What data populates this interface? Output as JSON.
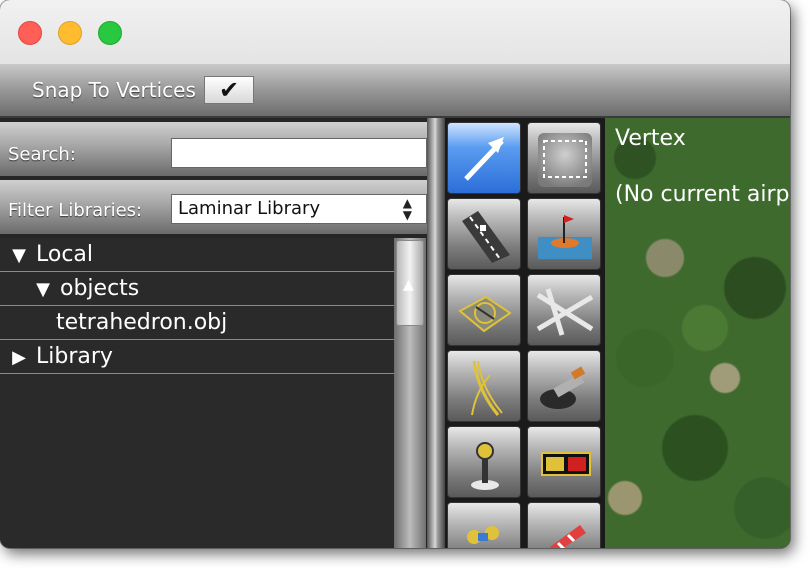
{
  "toolbar": {
    "snap_label": "Snap To Vertices",
    "snap_checked": true,
    "check_glyph": "✔"
  },
  "library": {
    "search_label": "Search:",
    "search_value": "",
    "filter_label": "Filter Libraries:",
    "filter_value": "Laminar Library",
    "tree": [
      {
        "label": "Local",
        "expanded": true,
        "indent": 0
      },
      {
        "label": "objects",
        "expanded": true,
        "indent": 1
      },
      {
        "label": "tetrahedron.obj",
        "leaf": true,
        "indent": 2
      },
      {
        "label": "Library",
        "expanded": false,
        "indent": 0
      }
    ]
  },
  "tools": [
    {
      "name": "vertex-tool",
      "icon": "arrow-icon",
      "selected": true
    },
    {
      "name": "marquee-tool",
      "icon": "marquee-icon",
      "selected": false
    },
    {
      "name": "runway-tool",
      "icon": "runway-icon",
      "selected": false
    },
    {
      "name": "sealane-tool",
      "icon": "sealane-icon",
      "selected": false
    },
    {
      "name": "helipad-tool",
      "icon": "helipad-icon",
      "selected": false
    },
    {
      "name": "taxiway-tool",
      "icon": "taxiway-icon",
      "selected": false
    },
    {
      "name": "taxi-route-tool",
      "icon": "taxi-route-icon",
      "selected": false
    },
    {
      "name": "boundary-tool",
      "icon": "boundary-icon",
      "selected": false
    },
    {
      "name": "light-tool",
      "icon": "light-fixture-icon",
      "selected": false
    },
    {
      "name": "sign-tool",
      "icon": "taxi-sign-icon",
      "selected": false
    },
    {
      "name": "beacon-tool",
      "icon": "beacon-icon",
      "selected": false
    },
    {
      "name": "windsock-tool",
      "icon": "windsock-icon",
      "selected": false
    }
  ],
  "map": {
    "tool_title": "Vertex",
    "status": "(No current airport)"
  },
  "colors": {
    "selected_tool": "#2b6ed8",
    "panel_bg": "#2a2a2a"
  }
}
